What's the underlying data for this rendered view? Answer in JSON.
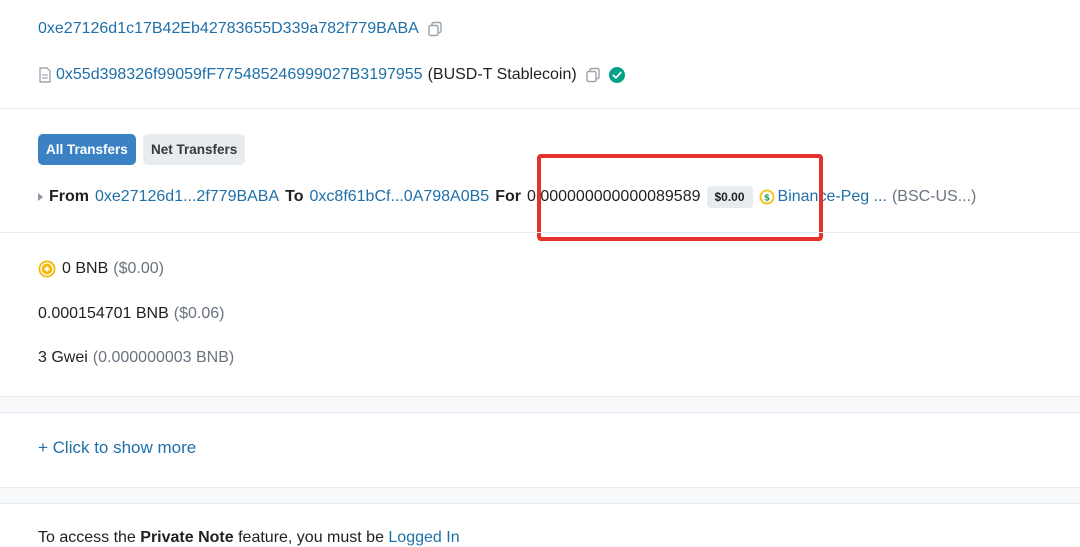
{
  "addresses": {
    "from_full": "0xe27126d1c17B42Eb42783655D339a782f779BABA",
    "token_contract": "0x55d398326f99059fF775485246999027B3197955",
    "token_name": "(BUSD-T Stablecoin)"
  },
  "tabs": [
    {
      "label": "All Transfers",
      "active": true
    },
    {
      "label": "Net Transfers",
      "active": false
    }
  ],
  "transfer": {
    "from_label": "From",
    "from_short": "0xe27126d1...2f779BABA",
    "to_label": "To",
    "to_short": "0xc8f61bCf...0A798A0B5",
    "for_label": "For",
    "amount": "0.000000000000089589",
    "usd_value": "$0.00",
    "token_link": "Binance-Peg ...",
    "token_symbol": "(BSC-US...)"
  },
  "details": {
    "value_amount": "0 BNB",
    "value_usd": "($0.00)",
    "fee_amount": "0.000154701 BNB",
    "fee_usd": "($0.06)",
    "gas_price": "3 Gwei",
    "gas_price_bnb": "(0.000000003 BNB)"
  },
  "show_more": "+ Click to show more",
  "private_note": {
    "prefix": "To access the ",
    "feature": "Private Note",
    "middle": " feature, you must be ",
    "link": "Logged In"
  },
  "colors": {
    "link": "#1f6fa8",
    "tab_active_bg": "#3b82c4",
    "highlight_border": "#e5322d",
    "verified_check": "#00a186"
  },
  "icons": [
    "copy-icon",
    "document-icon",
    "verified-check-icon",
    "expand-caret-icon",
    "token-coin-icon",
    "bnb-coin-icon"
  ]
}
